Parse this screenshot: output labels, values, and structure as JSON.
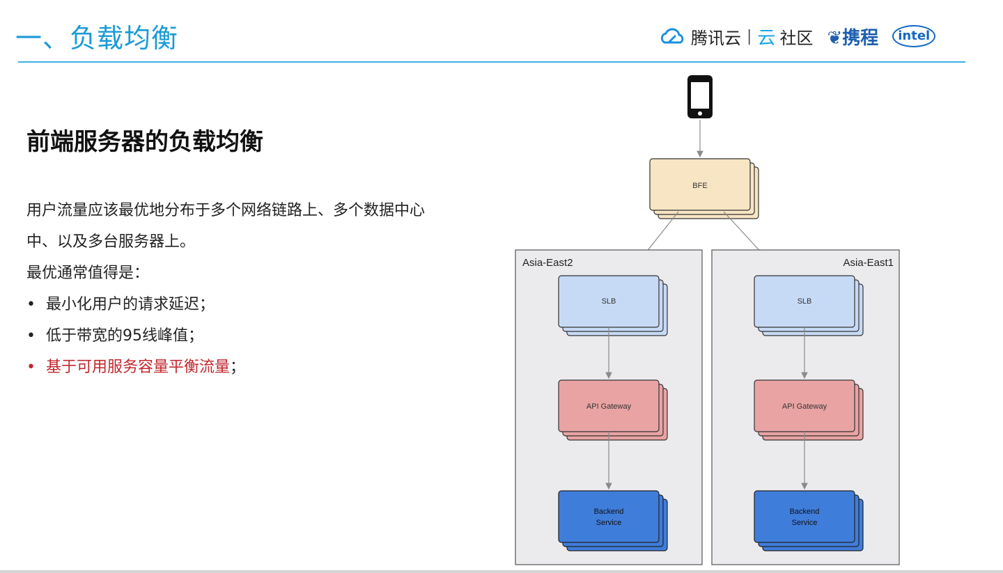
{
  "header": {
    "section_title": "一、负载均衡",
    "logos": {
      "tencent": "腾讯云",
      "separator": "|",
      "yun": "云",
      "community": "社区",
      "ctrip": "携程",
      "intel": "intel"
    }
  },
  "content": {
    "subtitle": "前端服务器的负载均衡",
    "paragraph": "用户流量应该最优地分布于多个网络链路上、多个数据中心中、以及多台服务器上。",
    "criteria_label": "最优通常值得是：",
    "bullets": [
      {
        "text": "最小化用户的请求延迟；",
        "highlight": false
      },
      {
        "text": "低于带宽的95线峰值；",
        "highlight": false
      },
      {
        "text": "基于可用服务容量平衡流量",
        "suffix": "；",
        "highlight": true
      }
    ]
  },
  "diagram": {
    "bfe": "BFE",
    "regions": [
      {
        "name": "Asia-East2",
        "slb": "SLB",
        "gateway": "API Gateway",
        "backend": [
          "Backend",
          "Service"
        ]
      },
      {
        "name": "Asia-East1",
        "slb": "SLB",
        "gateway": "API Gateway",
        "backend": [
          "Backend",
          "Service"
        ]
      }
    ],
    "colors": {
      "bfe": "#f7e5c4",
      "slb": "#c7daf5",
      "gateway": "#e9a3a3",
      "backend": "#3f7ddb",
      "region_bg": "#ebebee",
      "arrow": "#8a8a8a"
    }
  }
}
